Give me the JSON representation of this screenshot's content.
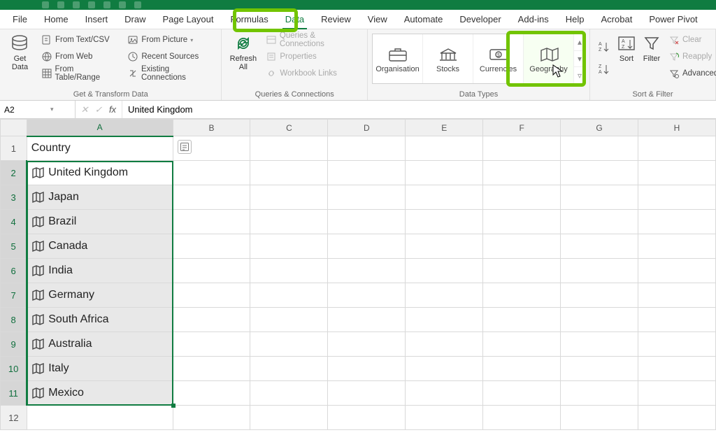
{
  "tabs": {
    "file": "File",
    "home": "Home",
    "insert": "Insert",
    "draw": "Draw",
    "page_layout": "Page Layout",
    "formulas": "Formulas",
    "data": "Data",
    "review": "Review",
    "view": "View",
    "automate": "Automate",
    "developer": "Developer",
    "addins": "Add-ins",
    "help": "Help",
    "acrobat": "Acrobat",
    "power_pivot": "Power Pivot"
  },
  "ribbon": {
    "get_data": "Get\nData",
    "from_text_csv": "From Text/CSV",
    "from_web": "From Web",
    "from_table_range": "From Table/Range",
    "from_picture": "From Picture",
    "recent_sources": "Recent Sources",
    "existing_connections": "Existing Connections",
    "group_get_transform": "Get & Transform Data",
    "refresh_all": "Refresh\nAll",
    "queries_connections": "Queries & Connections",
    "properties": "Properties",
    "workbook_links": "Workbook Links",
    "group_queries": "Queries & Connections",
    "dt_organisation": "Organisation",
    "dt_stocks": "Stocks",
    "dt_currencies": "Currencies",
    "dt_geography": "Geography",
    "group_data_types": "Data Types",
    "sort": "Sort",
    "filter": "Filter",
    "clear": "Clear",
    "reapply": "Reapply",
    "advanced": "Advanced",
    "group_sort_filter": "Sort & Filter"
  },
  "namebox": "A2",
  "formula": "United Kingdom",
  "columns": [
    "A",
    "B",
    "C",
    "D",
    "E",
    "F",
    "G",
    "H"
  ],
  "rows": [
    "1",
    "2",
    "3",
    "4",
    "5",
    "6",
    "7",
    "8",
    "9",
    "10",
    "11",
    "12"
  ],
  "sheet": {
    "a1": "Country",
    "countries": [
      "United Kingdom",
      "Japan",
      "Brazil",
      "Canada",
      "India",
      "Germany",
      "South Africa",
      "Australia",
      "Italy",
      "Mexico"
    ]
  }
}
